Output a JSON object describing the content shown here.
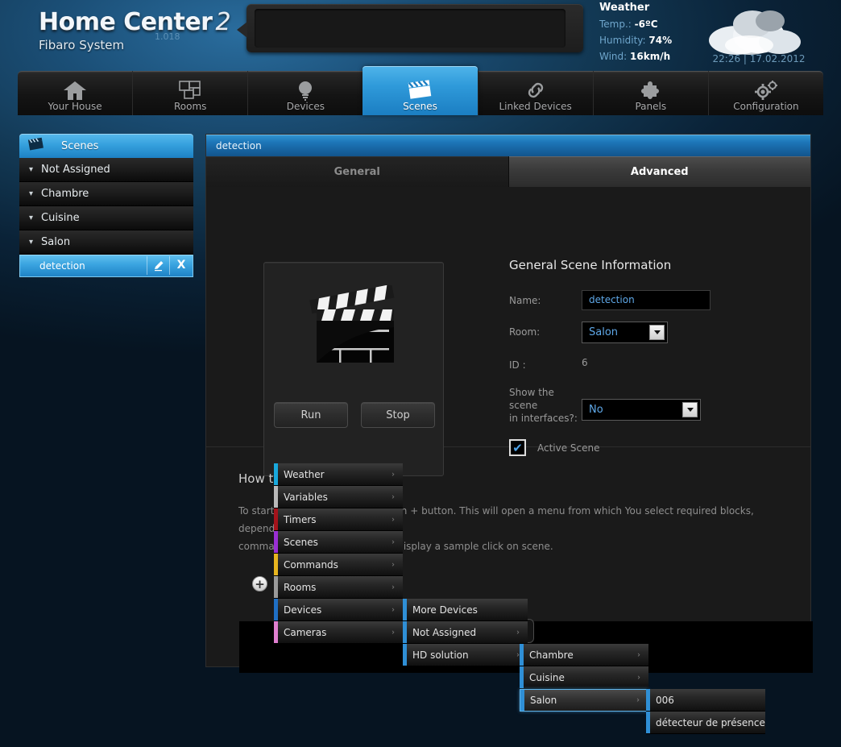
{
  "header": {
    "brand_line1": "Home Center",
    "brand_two": "2",
    "brand_line2": "Fibaro System",
    "version": "1.018",
    "weather": {
      "title": "Weather",
      "temp_label": "Temp.:",
      "temp_value": "-6ºC",
      "humidity_label": "Humidity:",
      "humidity_value": "74%",
      "wind_label": "Wind:",
      "wind_value": "16km/h",
      "icon": "cloud-icon",
      "datetime": "22:26 | 17.02.2012"
    }
  },
  "nav": {
    "items": [
      {
        "label": "Your House",
        "icon": "house-icon",
        "active": false
      },
      {
        "label": "Rooms",
        "icon": "rooms-icon",
        "active": false
      },
      {
        "label": "Devices",
        "icon": "bulb-icon",
        "active": false
      },
      {
        "label": "Scenes",
        "icon": "clapperboard-icon",
        "active": true
      },
      {
        "label": "Linked Devices",
        "icon": "link-icon",
        "active": false
      },
      {
        "label": "Panels",
        "icon": "puzzle-icon",
        "active": false
      },
      {
        "label": "Configuration",
        "icon": "gears-icon",
        "active": false
      }
    ]
  },
  "sidebar": {
    "header_label": "Scenes",
    "header_icon": "clapperboard-icon",
    "groups": [
      {
        "label": "Not Assigned"
      },
      {
        "label": "Chambre"
      },
      {
        "label": "Cuisine"
      },
      {
        "label": "Salon"
      }
    ],
    "selected_scene": {
      "label": "detection",
      "edit_icon": "pencil-icon",
      "delete_icon": "x-icon"
    }
  },
  "main": {
    "title": "detection",
    "tabs": [
      {
        "label": "General",
        "active": false
      },
      {
        "label": "Advanced",
        "active": true
      }
    ],
    "preview": {
      "icon": "clapperboard-icon",
      "run_label": "Run",
      "stop_label": "Stop"
    },
    "form": {
      "heading": "General Scene Information",
      "name_label": "Name:",
      "name_value": "detection",
      "room_label": "Room:",
      "room_value": "Salon",
      "id_label": "ID :",
      "id_value": "6",
      "show_label_line1": "Show the scene",
      "show_label_line2": "in interfaces?:",
      "show_value": "No",
      "active_scene_label": "Active Scene",
      "active_scene_checked": true
    },
    "howto": {
      "heading": "How to start?",
      "paragraph_line1": "To start creating the scene click on + button. This will open a menu from which You select required blocks, depending on type of",
      "paragraph_line2": "command. Selecting Scenes will display a sample click on scene.",
      "add_button": "+"
    }
  },
  "menus": {
    "root": [
      {
        "label": "Weather",
        "color": "#19a9dd",
        "arrow": true
      },
      {
        "label": "Variables",
        "color": "#b9b9b9",
        "arrow": true
      },
      {
        "label": "Timers",
        "color": "#a4131b",
        "arrow": true
      },
      {
        "label": "Scenes",
        "color": "#9a2fd4",
        "arrow": true
      },
      {
        "label": "Commands",
        "color": "#e8b51f",
        "arrow": true
      },
      {
        "label": "Rooms",
        "color": "#9a9a9a",
        "arrow": true
      },
      {
        "label": "Devices",
        "color": "#1f6fc4",
        "arrow": true
      },
      {
        "label": "Cameras",
        "color": "#e07fd0",
        "arrow": true
      }
    ],
    "devices": [
      {
        "label": "More Devices",
        "color": "#2f8fd6",
        "arrow": false
      },
      {
        "label": "Not Assigned",
        "color": "#2f8fd6",
        "arrow": true
      },
      {
        "label": "HD solution",
        "color": "#2f8fd6",
        "arrow": true
      }
    ],
    "hd_solution": [
      {
        "label": "Chambre",
        "color": "#2f8fd6",
        "arrow": true,
        "selected": false
      },
      {
        "label": "Cuisine",
        "color": "#2f8fd6",
        "arrow": true,
        "selected": false
      },
      {
        "label": "Salon",
        "color": "#2f8fd6",
        "arrow": true,
        "selected": true
      }
    ],
    "salon": [
      {
        "label": "006",
        "color": "#2f8fd6",
        "arrow": false
      },
      {
        "label": "détecteur de présence",
        "color": "#2f8fd6",
        "arrow": false
      }
    ]
  }
}
